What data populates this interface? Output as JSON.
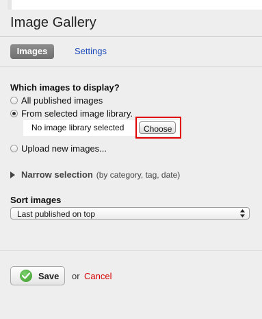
{
  "page": {
    "title": "Image Gallery"
  },
  "tabs": {
    "active_label": "Images",
    "settings_label": "Settings"
  },
  "display": {
    "heading": "Which images to display?",
    "options": [
      {
        "label": "All published images",
        "checked": false
      },
      {
        "label": "From selected image library.",
        "checked": true
      },
      {
        "label": "Upload new images...",
        "checked": false
      }
    ],
    "library_status": "No image library selected",
    "choose_label": "Choose"
  },
  "narrow": {
    "label": "Narrow selection",
    "hint": "(by category, tag, date)"
  },
  "sort": {
    "heading": "Sort images",
    "selected": "Last published on top"
  },
  "actions": {
    "save_label": "Save",
    "or_text": "or",
    "cancel_label": "Cancel"
  },
  "colors": {
    "link": "#1a4ab8",
    "cancel": "#d40000",
    "highlight": "#e00000",
    "save_check": "#3c9a2c"
  }
}
